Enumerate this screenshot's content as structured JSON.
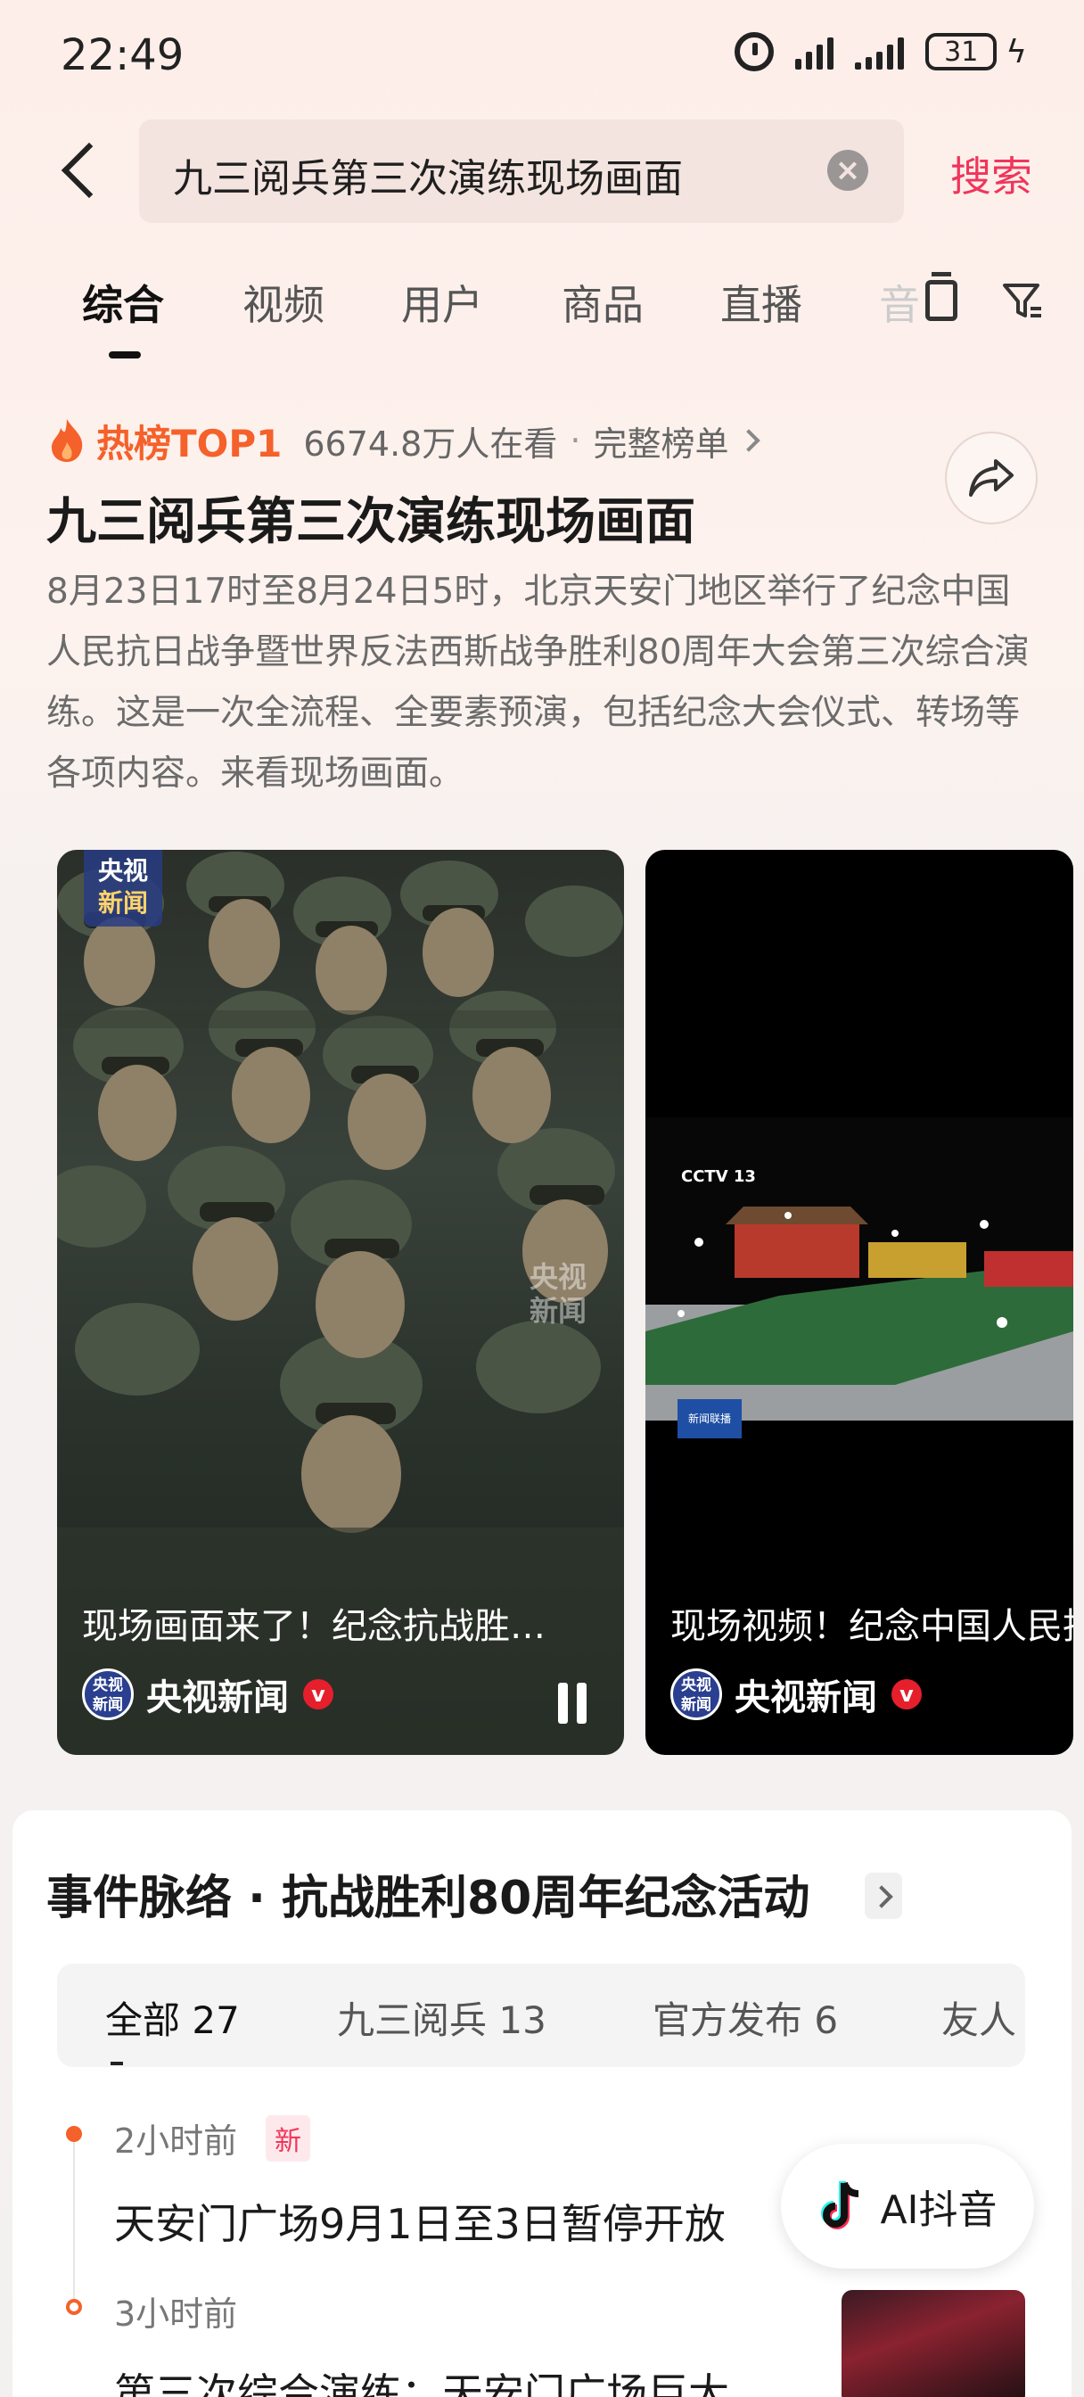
{
  "status_bar": {
    "time": "22:49",
    "battery": "31"
  },
  "search": {
    "query": "九三阅兵第三次演练现场画面",
    "button": "搜索"
  },
  "tabs": [
    "综合",
    "视频",
    "用户",
    "商品",
    "直播"
  ],
  "hot": {
    "tag": "热榜TOP1",
    "viewers": "6674.8万人在看",
    "full_list": "完整榜单",
    "title": "九三阅兵第三次演练现场画面",
    "summary": "8月23日17时至8月24日5时，北京天安门地区举行了纪念中国人民抗日战争暨世界反法西斯战争胜利80周年大会第三次综合演练。这是一次全流程、全要素预演，包括纪念大会仪式、转场等各项内容。来看现场画面。"
  },
  "videos": [
    {
      "title": "现场画面来了！纪念抗战胜…",
      "author": "央视新闻",
      "logo_top": "央视",
      "logo_bottom": "新闻",
      "watermark": "央视\n新闻"
    },
    {
      "title": "现场视频！纪念中国人民抗",
      "author": "央视新闻",
      "badge": "CCTV 13",
      "corner_label": "新闻联播"
    }
  ],
  "timeline": {
    "title": "事件脉络 · 抗战胜利80周年纪念活动",
    "filters": [
      "全部 27",
      "九三阅兵 13",
      "官方发布 6",
      "友人"
    ],
    "items": [
      {
        "time": "2小时前",
        "badge": "新",
        "text": "天安门广场9月1日至3日暂停开放"
      },
      {
        "time": "3小时前",
        "text": "第三次综合演练：天安门广场巨大"
      }
    ]
  },
  "ai_button": {
    "label": "AI抖音"
  },
  "colors": {
    "accent": "#f0355a",
    "hot": "#f5612a"
  }
}
